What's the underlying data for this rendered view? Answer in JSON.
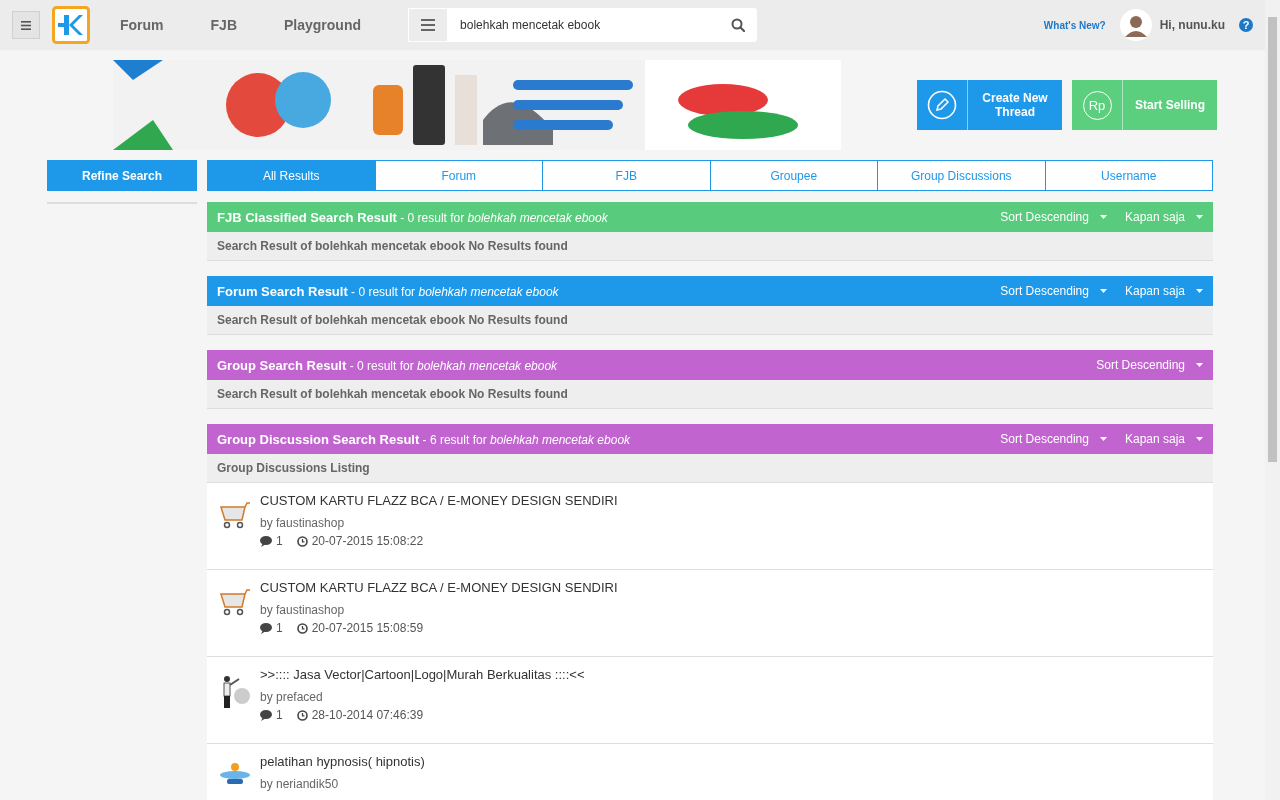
{
  "nav": {
    "links": [
      "Forum",
      "FJB",
      "Playground"
    ]
  },
  "search": {
    "value": "bolehkah mencetak ebook"
  },
  "user": {
    "whats_new": "What's New?",
    "greeting": "Hi, nunu.ku",
    "help": "?"
  },
  "actions": [
    {
      "kind": "create",
      "label": "Create New Thread"
    },
    {
      "kind": "sell",
      "label": "Start Selling",
      "icon_text": "Rp"
    }
  ],
  "refine": "Refine Search",
  "tabs": [
    {
      "label": "All Results",
      "selected": true
    },
    {
      "label": "Forum",
      "selected": false
    },
    {
      "label": "FJB",
      "selected": false
    },
    {
      "label": "Groupee",
      "selected": false
    },
    {
      "label": "Group Discussions",
      "selected": false
    },
    {
      "label": "Username",
      "selected": false
    }
  ],
  "sections": [
    {
      "title": "FJB Classified Search Result",
      "summary": "- 0 result for",
      "query": "bolehkah mencetak ebook",
      "color": "#58cc7c",
      "sort": "Sort Descending",
      "time": "Kapan saja",
      "body": "Search Result of bolehkah mencetak ebook No Results found"
    },
    {
      "title": "Forum Search Result",
      "summary": "- 0 result for",
      "query": "bolehkah mencetak ebook",
      "color": "#1e98e8",
      "sort": "Sort Descending",
      "time": "Kapan saja",
      "body": "Search Result of bolehkah mencetak ebook No Results found"
    },
    {
      "title": "Group Search Result",
      "summary": "- 0 result for",
      "query": "bolehkah mencetak ebook",
      "color": "#c264cf",
      "sort": "Sort Descending",
      "body": "Search Result of bolehkah mencetak ebook No Results found"
    },
    {
      "title": "Group Discussion Search Result",
      "summary": "- 6 result for",
      "query": "bolehkah mencetak ebook",
      "color": "#c264cf",
      "sort": "Sort Descending",
      "time": "Kapan saja",
      "body": "Group Discussions Listing",
      "threads": [
        {
          "kind": "cart",
          "title": "CUSTOM KARTU FLAZZ BCA / E-MONEY DESIGN SENDIRI",
          "author": "by faustinashop",
          "comments": "1",
          "date": "20-07-2015 15:08:22"
        },
        {
          "kind": "cart",
          "title": "CUSTOM KARTU FLAZZ BCA / E-MONEY DESIGN SENDIRI",
          "author": "by faustinashop",
          "comments": "1",
          "date": "20-07-2015 15:08:59"
        },
        {
          "kind": "figure",
          "title": ">>:::: Jasa Vector|Cartoon|Logo|Murah Berkualitas ::::<<",
          "author": "by prefaced",
          "comments": "1",
          "date": "28-10-2014 07:46:39"
        },
        {
          "kind": "picture",
          "title": "pelatihan hypnosis( hipnotis)",
          "author": "by neriandik50"
        }
      ]
    }
  ]
}
